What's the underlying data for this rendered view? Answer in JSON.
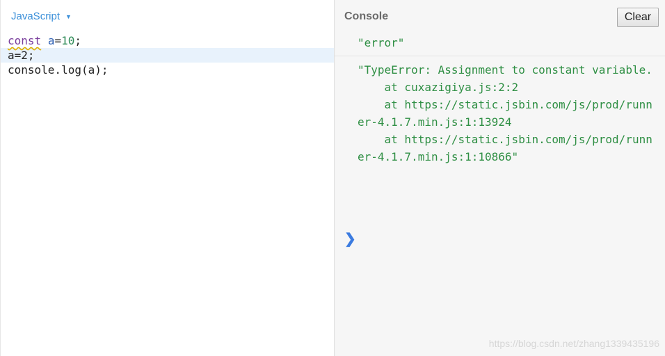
{
  "editor": {
    "language_label": "JavaScript",
    "lines": [
      {
        "kw": "const",
        "var": "a",
        "op": "=",
        "num": "10",
        "end": ";"
      },
      {
        "text": "a=2;"
      },
      {
        "text": "console.log(a);"
      }
    ]
  },
  "console": {
    "title": "Console",
    "clear_label": "Clear",
    "entries": [
      "\"error\"",
      "\"TypeError: Assignment to constant variable.\n    at cuxazigiya.js:2:2\n    at https://static.jsbin.com/js/prod/runner-4.1.7.min.js:1:13924\n    at https://static.jsbin.com/js/prod/runner-4.1.7.min.js:1:10866\""
    ],
    "prompt_icon": "chevron-right-icon",
    "prompt_glyph": "❯"
  },
  "watermark": "https://blog.csdn.net/zhang1339435196",
  "colors": {
    "language_label": "#3a8fd9",
    "console_text": "#2f8f44",
    "prompt": "#3b7be0",
    "active_line": "#e8f2fc"
  }
}
